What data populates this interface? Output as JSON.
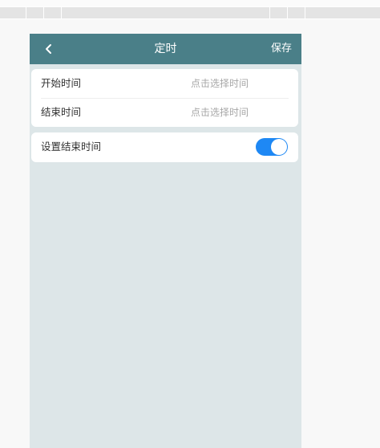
{
  "navbar": {
    "title": "定时",
    "save_label": "保存",
    "back_icon": "chevron-left-icon",
    "background": "#4a7f88"
  },
  "schedule": {
    "start": {
      "label": "开始时间",
      "placeholder": "点击选择时间"
    },
    "end": {
      "label": "结束时间",
      "placeholder": "点击选择时间"
    }
  },
  "end_time_setting": {
    "label": "设置结束时间",
    "enabled": true,
    "toggle_color": "#1e88f4"
  },
  "colors": {
    "page_background": "#dde6e8",
    "card_background": "#ffffff"
  }
}
